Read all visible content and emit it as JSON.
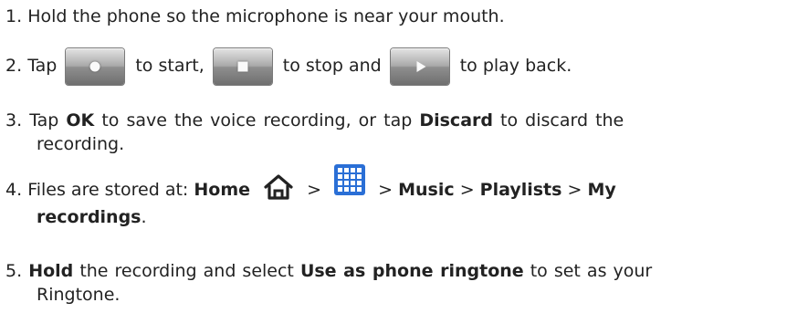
{
  "steps": [
    {
      "num": "1.",
      "text": "Hold the phone so the microphone is near your mouth."
    },
    {
      "num": "2.",
      "tap": "Tap",
      "to_start": "to start,",
      "to_stop": "to stop and",
      "to_play": "to play back.",
      "icons": [
        "record-icon",
        "stop-icon",
        "play-icon"
      ]
    },
    {
      "num": "3.",
      "tap": "Tap",
      "ok": "OK",
      "middle": "to save the voice recording, or tap",
      "discard": "Discard",
      "end1": "to discard the",
      "end2": "recording."
    },
    {
      "num": "4.",
      "prefix": "Files are stored at:",
      "home": "Home",
      "sep": ">",
      "music": "Music",
      "playlists": "Playlists",
      "my": "My",
      "recordings": "recordings",
      "period": ".",
      "icons": [
        "home-icon",
        "apps-grid-icon"
      ]
    },
    {
      "num": "5.",
      "hold": "Hold",
      "mid": "the recording and select",
      "use": "Use as phone ringtone",
      "end1": "to set as your",
      "end2": "Ringtone."
    }
  ],
  "colors": {
    "text": "#222222",
    "grid_icon_blue": "#2a6fd6",
    "button_gray": "#9a9a9a"
  }
}
